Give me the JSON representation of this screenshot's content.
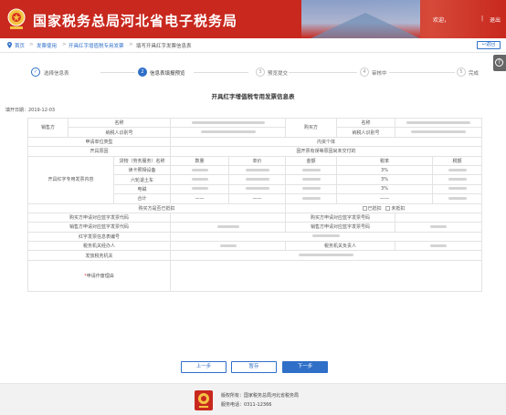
{
  "header": {
    "title": "国家税务总局河北省电子税务局",
    "welcome": "欢迎，",
    "separator": "|",
    "logout": "退出"
  },
  "breadcrumb": {
    "items": [
      "首页",
      "发票使用",
      "开具红字增值税专用发票",
      "填写开具红字发票信息表"
    ],
    "separator": ">"
  },
  "back_button": "返回",
  "steps": [
    {
      "num": "✓",
      "label": "选择信息表",
      "state": "done"
    },
    {
      "num": "2",
      "label": "信息表填报预览",
      "state": "active"
    },
    {
      "num": "3",
      "label": "预览提交",
      "state": "todo"
    },
    {
      "num": "4",
      "label": "审核中",
      "state": "todo"
    },
    {
      "num": "5",
      "label": "完成",
      "state": "todo"
    }
  ],
  "form": {
    "title": "开具红字增值税专用发票信息表",
    "fill_date": "填开日期：2019-12-03",
    "seller": {
      "section": "销售方",
      "name_label": "名称",
      "taxid_label": "纳税人识别号"
    },
    "buyer": {
      "section": "购买方",
      "name_label": "名称",
      "taxid_label": "纳税人识别号"
    },
    "applicant_type_label": "申请单位类型",
    "applicant_type_value": "内资个体",
    "reason_label": "开具原因",
    "reason_value": "因开票有误等原因尚未交付的",
    "items_section": "开具红字专用发票内容",
    "columns": [
      "货物（劳务服务）名称",
      "数量",
      "单价",
      "金额",
      "税率",
      "税额"
    ],
    "items": [
      {
        "name": "读卡照相设备",
        "rate": "3%"
      },
      {
        "name": "六轮退土车",
        "rate": "3%"
      },
      {
        "name": "电磁",
        "rate": "3%"
      }
    ],
    "total_label": "合计",
    "dash": "——",
    "deduct_label": "购买方是否已抵扣",
    "deduct_yes": "已抵扣",
    "deduct_no": "未抵扣",
    "buyer_code_label": "购买方申请对应蓝字发票代码",
    "buyer_no_label": "购买方申请对应蓝字发票号码",
    "seller_code_label": "销售方申请对应蓝字发票代码",
    "seller_no_label": "销售方申请对应蓝字发票号码",
    "red_no_label": "红字发票信息表编号",
    "tax_officer_label": "税务机关经办人",
    "tax_head_label": "税务机关负责人",
    "issuer_label": "发放税务机关",
    "apply_reason_label": "申请作废理由"
  },
  "buttons": {
    "prev": "上一步",
    "save": "暂存",
    "next": "下一步"
  },
  "footer": {
    "copyright": "版权所有：国家税务总局河北省税务局",
    "phone": "服务电话：0311-12366"
  },
  "colors": {
    "header_red": "#c8281e",
    "accent_blue": "#2f6fc8"
  }
}
